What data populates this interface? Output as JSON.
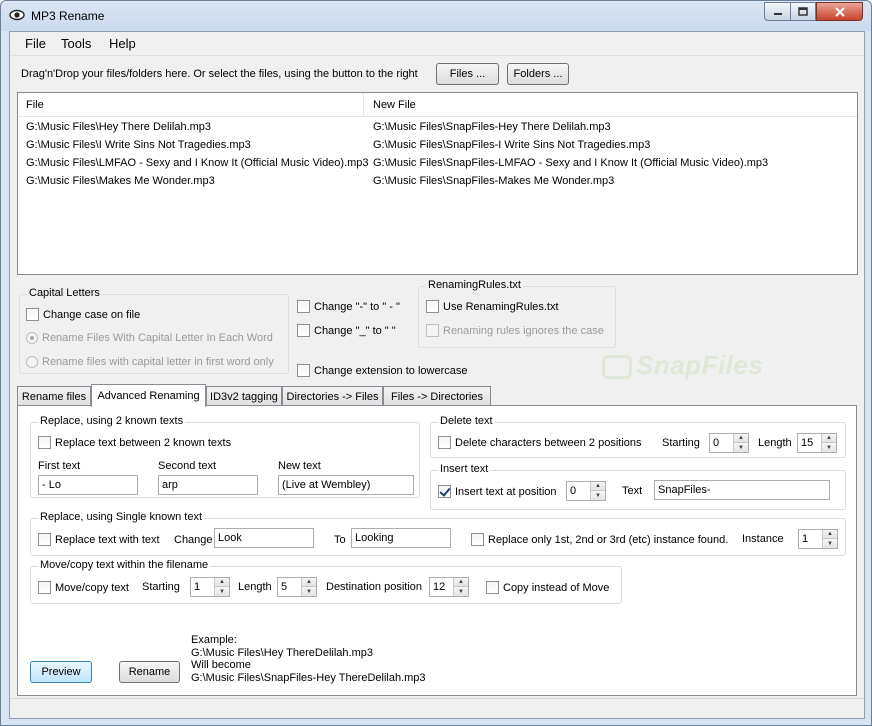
{
  "window": {
    "title": "MP3 Rename"
  },
  "menu": [
    "File",
    "Tools",
    "Help"
  ],
  "toolbar": {
    "instruction": "Drag'n'Drop your files/folders here. Or select the files, using the button to the right",
    "files_button": "Files ...",
    "folders_button": "Folders ..."
  },
  "filelist": {
    "columns": [
      "File",
      "New File"
    ],
    "rows": [
      [
        "G:\\Music Files\\Hey There Delilah.mp3",
        "G:\\Music Files\\SnapFiles-Hey There Delilah.mp3"
      ],
      [
        "G:\\Music Files\\I Write Sins Not Tragedies.mp3",
        "G:\\Music Files\\SnapFiles-I Write Sins Not Tragedies.mp3"
      ],
      [
        "G:\\Music Files\\LMFAO - Sexy and I Know It (Official Music Video).mp3",
        "G:\\Music Files\\SnapFiles-LMFAO - Sexy and I Know It (Official Music Video).mp3"
      ],
      [
        "G:\\Music Files\\Makes Me Wonder.mp3",
        "G:\\Music Files\\SnapFiles-Makes Me Wonder.mp3"
      ]
    ]
  },
  "capital_letters": {
    "title": "Capital Letters",
    "change_case": "Change case on file",
    "option_each_word": "Rename Files With Capital Letter In Each Word",
    "option_first_word": "Rename files with capital letter in first word only"
  },
  "options": {
    "dash": "Change \"-\" to \" - \"",
    "underscore": "Change \"_\" to \" \"",
    "lowercase_ext": "Change extension to lowercase"
  },
  "renaming_rules": {
    "title": "RenamingRules.txt",
    "use": "Use RenamingRules.txt",
    "ignores_case": "Renaming rules ignores the case"
  },
  "watermark": "SnapFiles",
  "tabs": [
    "Rename files",
    "Advanced Renaming",
    "ID3v2 tagging",
    "Directories -> Files",
    "Files -> Directories"
  ],
  "advanced": {
    "replace2": {
      "title": "Replace, using 2 known texts",
      "checkbox": "Replace text between 2 known texts",
      "first_label": "First text",
      "first_value": "- Lo",
      "second_label": "Second text",
      "second_value": "arp",
      "new_label": "New text",
      "new_value": "(Live at Wembley)"
    },
    "delete": {
      "title": "Delete text",
      "checkbox": "Delete characters between 2 positions",
      "starting_label": "Starting",
      "starting_value": "0",
      "length_label": "Length",
      "length_value": "15"
    },
    "insert": {
      "title": "Insert text",
      "checkbox": "Insert text at position",
      "position_value": "0",
      "text_label": "Text",
      "text_value": "SnapFiles-"
    },
    "replace1": {
      "title": "Replace, using Single known text",
      "checkbox": "Replace text with text",
      "change_label": "Change",
      "change_value": "Look",
      "to_label": "To",
      "to_value": "Looking",
      "only_instance": "Replace only 1st, 2nd or 3rd (etc) instance found.",
      "instance_label": "Instance",
      "instance_value": "1"
    },
    "move": {
      "title": "Move/copy text within the filename",
      "checkbox": "Move/copy text",
      "starting_label": "Starting",
      "starting_value": "1",
      "length_label": "Length",
      "length_value": "5",
      "dest_label": "Destination position",
      "dest_value": "12",
      "copy_instead": "Copy instead of Move"
    }
  },
  "actions": {
    "preview": "Preview",
    "rename": "Rename"
  },
  "example": {
    "line1": "Example:",
    "line2": "G:\\Music Files\\Hey ThereDelilah.mp3",
    "line3": "Will become",
    "line4": "G:\\Music Files\\SnapFiles-Hey ThereDelilah.mp3"
  },
  "colors": {
    "title_bar": "#d4e0ef",
    "close_button": "#c8432c",
    "default_button": "#bee6fd"
  }
}
